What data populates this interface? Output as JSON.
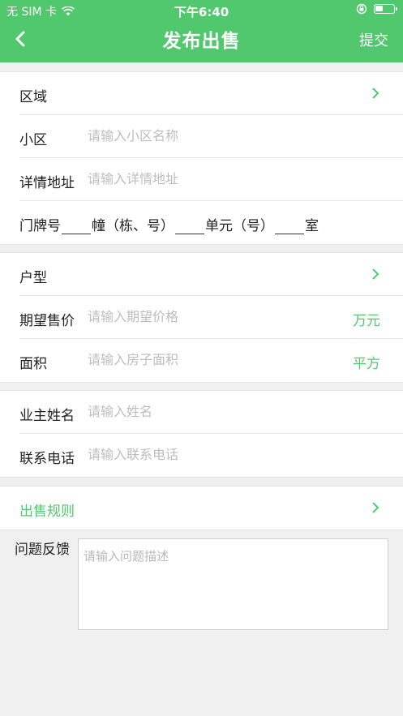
{
  "status": {
    "carrier": "无 SIM 卡",
    "time": "下午6:40"
  },
  "nav": {
    "title": "发布出售",
    "submit": "提交"
  },
  "colors": {
    "brand": "#52c86e"
  },
  "section1": {
    "region": {
      "label": "区域"
    },
    "community": {
      "label": "小区",
      "placeholder": "请输入小区名称"
    },
    "address": {
      "label": "详情地址",
      "placeholder": "请输入详情地址"
    },
    "door": {
      "label": "门牌号",
      "building": "幢（栋、号）",
      "unit": "单元（号）",
      "room": "室"
    }
  },
  "section2": {
    "layout": {
      "label": "户型"
    },
    "price": {
      "label": "期望售价",
      "placeholder": "请输入期望价格",
      "unit": "万元"
    },
    "area": {
      "label": "面积",
      "placeholder": "请输入房子面积",
      "unit": "平方"
    }
  },
  "section3": {
    "owner": {
      "label": "业主姓名",
      "placeholder": "请输入姓名"
    },
    "phone": {
      "label": "联系电话",
      "placeholder": "请输入联系电话"
    }
  },
  "rules": {
    "label": "出售规则"
  },
  "feedback": {
    "label": "问题反馈",
    "placeholder": "请输入问题描述"
  }
}
